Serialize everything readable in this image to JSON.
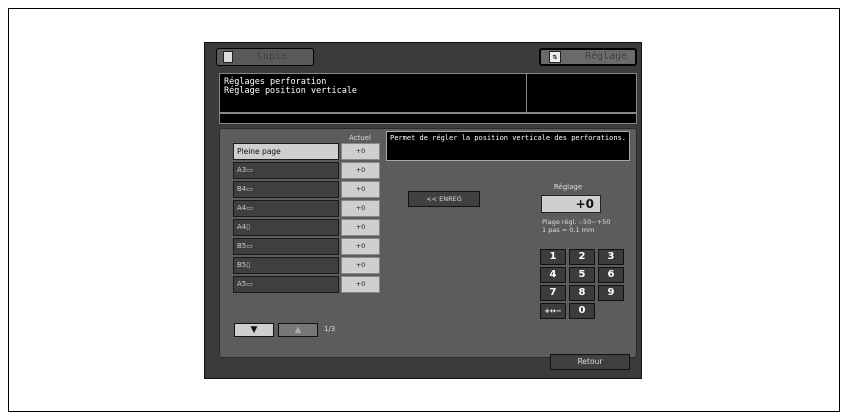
{
  "tabs": {
    "copie": {
      "label": "Copie"
    },
    "reglage": {
      "label": "Réglage",
      "icon": "adjust-icon"
    }
  },
  "header": {
    "line1": "Réglages perforation",
    "line2": "Réglage position verticale"
  },
  "list": {
    "column_header": "Actuel",
    "rows": [
      {
        "name": "Pleine page",
        "value": "+0",
        "selected": true
      },
      {
        "name": "A3▭",
        "value": "+0"
      },
      {
        "name": "B4▭",
        "value": "+0"
      },
      {
        "name": "A4▭",
        "value": "+0"
      },
      {
        "name": "A4▯",
        "value": "+0"
      },
      {
        "name": "B5▭",
        "value": "+0"
      },
      {
        "name": "B5▯",
        "value": "+0"
      },
      {
        "name": "A5▭",
        "value": "+0"
      }
    ],
    "pager": "1/3"
  },
  "message": "Permet de régler la position verticale des perforations.",
  "enreg_label": "<< ENREG",
  "reglage": {
    "label": "Réglage",
    "value": "+0",
    "range": "Plage régl. :-50~+50",
    "step": "1 pas = 0,1 mm"
  },
  "keypad": [
    "1",
    "2",
    "3",
    "4",
    "5",
    "6",
    "7",
    "8",
    "9",
    "+↔−",
    "0"
  ],
  "retour_label": "Retour"
}
